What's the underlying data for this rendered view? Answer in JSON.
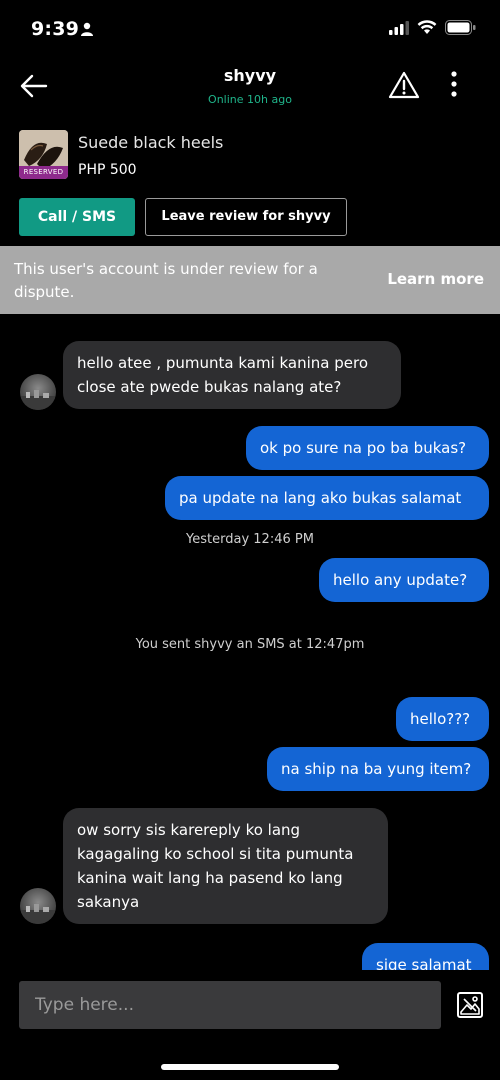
{
  "status": {
    "time": "9:39"
  },
  "header": {
    "title": "shyvy",
    "subtitle": "Online 10h ago"
  },
  "product": {
    "name": "Suede black heels",
    "price": "PHP 500",
    "badge": "RESERVED"
  },
  "actions": {
    "call_label": "Call / SMS",
    "review_label": "Leave review for shyvy"
  },
  "banner": {
    "text": "This user's account is under review for a dispute.",
    "link": "Learn more"
  },
  "messages": [
    {
      "from": "them",
      "text": "hello atee , pumunta kami kanina pero close ate pwede bukas nalang ate?"
    },
    {
      "from": "me",
      "text": "ok po sure na po ba bukas?"
    },
    {
      "from": "me",
      "text": "pa update na lang ako bukas salamat"
    },
    {
      "type": "stamp",
      "text": "Yesterday 12:46 PM"
    },
    {
      "from": "me",
      "text": "hello any update?"
    },
    {
      "type": "stamp",
      "text": "You sent shyvy an SMS at 12:47pm"
    },
    {
      "from": "me",
      "text": "hello???"
    },
    {
      "from": "me",
      "text": "na ship na ba yung item?"
    },
    {
      "from": "them",
      "text": "ow sorry sis karereply ko lang kagagaling ko school si tita pumunta kanina wait lang ha pasend ko lang sakanya"
    },
    {
      "from": "me",
      "text": "sige salamat"
    }
  ],
  "composer": {
    "placeholder": "Type here..."
  },
  "colors": {
    "accent": "#119a84",
    "online": "#1fb48a",
    "outgoing": "#1465d4",
    "incoming": "#2e2e30",
    "banner": "#a9a9a9",
    "badge": "#8e2a8c"
  }
}
